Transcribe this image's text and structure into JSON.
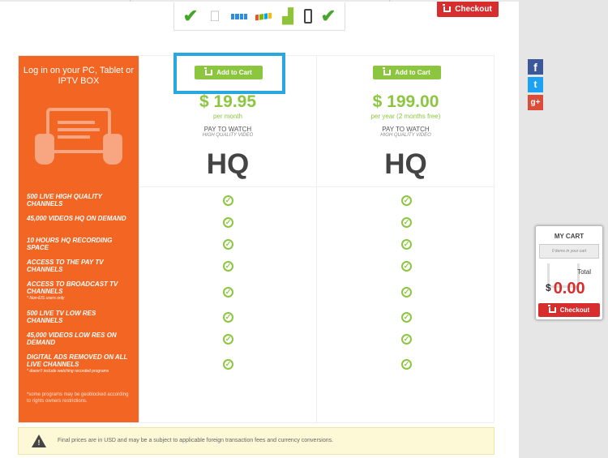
{
  "header": {
    "checkout_label": "Checkout",
    "platform_icons": [
      "check-icon",
      "apple-icon",
      "windows8-icon",
      "windows-icon",
      "android-icon",
      "phone-icon",
      "check-icon"
    ]
  },
  "pricing": {
    "intro": "Log in on your PC, Tablet or IPTV BOX",
    "features": [
      {
        "text": "500 LIVE HIGH QUALITY CHANNELS",
        "note": ""
      },
      {
        "text": "45,000 VIDEOS HQ ON DEMAND",
        "note": ""
      },
      {
        "text": "10 HOURS HQ RECORDING SPACE",
        "note": ""
      },
      {
        "text": "ACCESS TO THE PAY TV CHANNELS",
        "note": ""
      },
      {
        "text": "ACCESS TO BROADCAST TV CHANNELS",
        "note": "* Non-EIS users only"
      },
      {
        "text": "500 LIVE TV LOW RES CHANNELS",
        "note": ""
      },
      {
        "text": "45,000 VIDEOS LOW RES ON DEMAND",
        "note": ""
      },
      {
        "text": "DIGITAL ADS REMOVED ON ALL LIVE CHANNELS",
        "note": "* doesn't include watching recorded programs"
      }
    ],
    "footnote": "*some programs may be geoblocked according to rights owners restrictions.",
    "plans": [
      {
        "add_label": "Add to Cart",
        "price": "$ 19.95",
        "period": "per month",
        "pay_to_watch": "PAY TO WATCH",
        "quality": "HIGH QUALITY VIDEO",
        "badge": "HQ"
      },
      {
        "add_label": "Add to Cart",
        "price": "$ 199.00",
        "period": "per year (2 months free)",
        "pay_to_watch": "PAY TO WATCH",
        "quality": "HIGH QUALITY VIDEO",
        "badge": "HQ"
      }
    ]
  },
  "notice": {
    "text": "Final prices are in USD and may be a subject to applicable foreign transaction fees and currency conversions."
  },
  "social": [
    "f",
    "t",
    "g+"
  ],
  "cart": {
    "title": "MY CART",
    "items_text": "0 items in your cart",
    "total_label": "Total",
    "currency": "$",
    "amount": "0.00",
    "checkout_label": "Checkout"
  },
  "colors": {
    "accent_orange": "#f26522",
    "green": "#8cc63f",
    "red": "#d72d2d",
    "highlight": "#29a8e0"
  }
}
